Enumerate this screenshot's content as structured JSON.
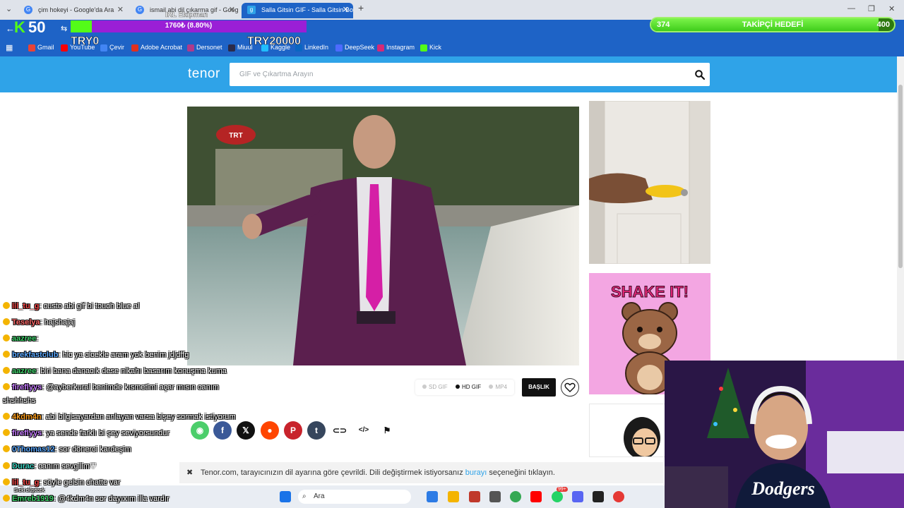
{
  "tabs": [
    {
      "title": "çim hokeyi - Google'da Ara"
    },
    {
      "title": "ismail abi dil çıkarma gif - Goog"
    },
    {
      "title": "Salla Gitsin GIF - Salla Gitsin Bo"
    }
  ],
  "bookmarks": [
    "Gmail",
    "YouTube",
    "Çevir",
    "Adobe Acrobat",
    "Dersonet",
    "Miuul",
    "Kaggle",
    "LinkedIn",
    "DeepSeek",
    "Instagram",
    "Kick"
  ],
  "overlay": {
    "kick_logo": "K",
    "kick_number": "50",
    "irl_label": "IRL Ekipman",
    "donation_text": "1760₺ (8.80%)",
    "donation_progress": 0.088,
    "donation_min": "TRY0",
    "donation_max": "TRY20000",
    "follow_current": "374",
    "follow_title": "TAKİPÇİ HEDEFİ",
    "follow_target": "400",
    "follow_progress": 0.935
  },
  "tenor": {
    "logo": "tenor",
    "search_placeholder": "GIF ve Çıkartma Arayın",
    "formats": [
      "SD GIF",
      "HD GIF",
      "MP4"
    ],
    "selected_format": "HD GIF",
    "caption_button": "BAŞLIK",
    "side_gif2_text": "SHAKE IT!",
    "main_gif_logo": "TRT"
  },
  "notice": {
    "text_before": "Tenor.com, tarayıcınızın dil ayarına göre çevrildi. Dili değiştirmek istiyorsanız ",
    "link": "burayı",
    "text_after": " seçeneğini tıklayın."
  },
  "taskbar": {
    "search_label": "Ara",
    "badge_count": "99+"
  },
  "chat": [
    {
      "user": "lil_tu_g",
      "user_color": "#ff4d4d",
      "message": ": custo abi gif bi touch blue al"
    },
    {
      "user": "Teselya",
      "user_color": "#ff6b6b",
      "message": ": hajshajaj"
    },
    {
      "user": "aazree",
      "user_color": "#3fd16b",
      "message": ":"
    },
    {
      "user": "brekfastclub",
      "user_color": "#5aa8ff",
      "message": ": hic ya cicekle aram yok benim jdjdffg"
    },
    {
      "user": "aazree",
      "user_color": "#3fd16b",
      "message": ": biri bana danacık dese nikahı basarım konuşma kuma"
    },
    {
      "user": "fireflyys",
      "user_color": "#c77dff",
      "message": ": @ayberkural benimde kısmetimi açar mısın canım"
    },
    {
      "user": "",
      "user_color": "#ffffff",
      "message": "shshhshs"
    },
    {
      "user": "4kdm4n",
      "user_color": "#ff9f1c",
      "message": ": abi bilgisayardan anlayan varsa bişey sormak istiyorum"
    },
    {
      "user": "fireflyys",
      "user_color": "#c77dff",
      "message": ": ya sende farklı bi şey seviyorsundur"
    },
    {
      "user": "0Thomas12",
      "user_color": "#5aa8ff",
      "message": ": sor dönerci kardeşim"
    },
    {
      "user": "Durac",
      "user_color": "#39d3c1",
      "message": ": canım sevgilim♡"
    },
    {
      "user": "lil_tu_g",
      "user_color": "#ff4d4d",
      "message": ": söyle gelsin chatte var"
    },
    {
      "user": "Emreb1919",
      "user_color": "#3fd16b",
      "message": ": @4kdm4n sor dayıxım illa vardır"
    }
  ],
  "chat_sub_label": "Sıcki düşecek",
  "webcam_shirt_text": "Dodgers",
  "colors": {
    "tenor_blue": "#2fa3e8",
    "browser_blue": "#1e63c6",
    "kick_green": "#53fc18",
    "donation_purple": "#9a1fd6"
  }
}
